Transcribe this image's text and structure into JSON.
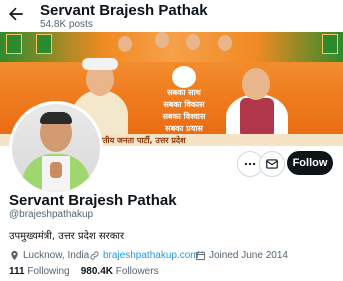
{
  "header": {
    "title": "Servant Brajesh Pathak",
    "posts": "54.8K posts"
  },
  "banner": {
    "slogans": [
      "सबका साथ",
      "सबका विकास",
      "सबका विश्वास",
      "सबका प्रयास"
    ],
    "footer_text": "भारतीय जनता पार्टी, उत्तर प्रदेश"
  },
  "profile": {
    "name": "Servant Brajesh Pathak",
    "handle": "@brajeshpathakup",
    "bio": "उपमुख्यमंत्री, उत्तर प्रदेश सरकार",
    "location": "Lucknow, India",
    "website": "brajeshpathakup.com",
    "joined": "Joined June 2014",
    "following_count": "111",
    "following_label": "Following",
    "followers_count": "980.4K",
    "followers_label": "Followers"
  },
  "actions": {
    "follow_label": "Follow"
  },
  "colors": {
    "follow_bg": "#0f1419",
    "link": "#1d9bf0",
    "muted": "#536471"
  },
  "icons": [
    "back-arrow-icon",
    "more-icon",
    "message-icon",
    "location-icon",
    "link-icon",
    "calendar-icon"
  ]
}
